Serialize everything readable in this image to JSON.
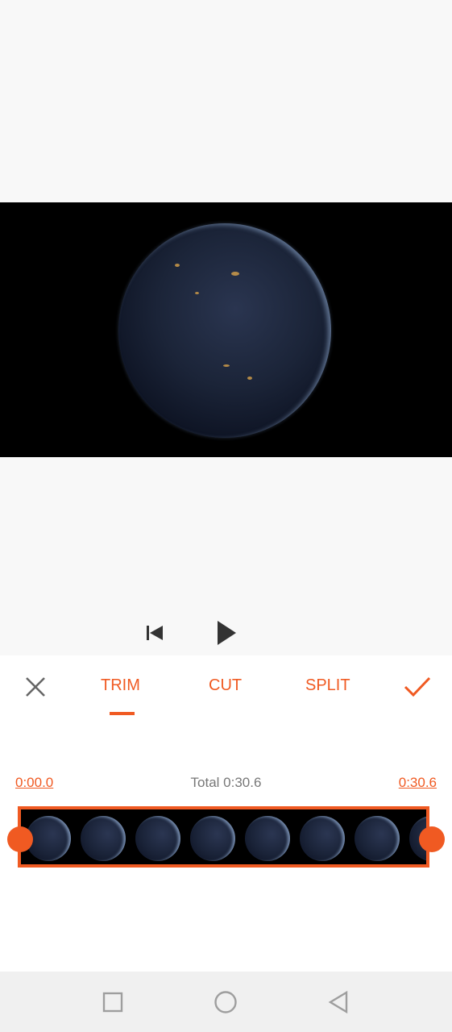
{
  "editor": {
    "tabs": [
      {
        "label": "TRIM",
        "active": true
      },
      {
        "label": "CUT",
        "active": false
      },
      {
        "label": "SPLIT",
        "active": false
      }
    ],
    "cancel_icon": "close-icon",
    "confirm_icon": "check-icon",
    "accent_color": "#f05a22"
  },
  "playback": {
    "rewind_icon": "skip-to-start-icon",
    "play_icon": "play-icon"
  },
  "trim": {
    "start_time": "0:00.0",
    "total_label": "Total 0:30.6",
    "end_time": "0:30.6",
    "thumbnail_count": 8
  },
  "system_nav": {
    "recents_icon": "square-icon",
    "home_icon": "circle-icon",
    "back_icon": "triangle-back-icon"
  }
}
